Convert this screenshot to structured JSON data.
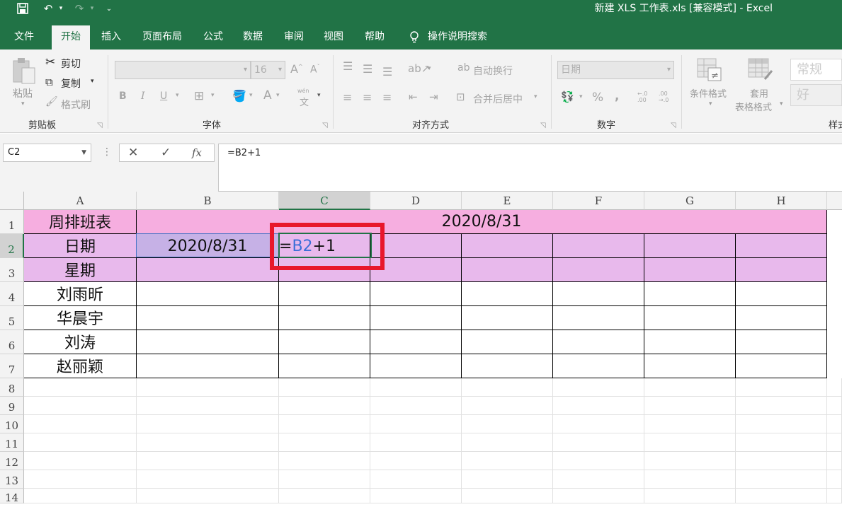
{
  "window": {
    "title": "新建 XLS 工作表.xls  [兼容模式]  -  Excel",
    "qat": {
      "save_icon": "save-icon",
      "undo_icon": "undo-icon",
      "redo_icon": "redo-icon",
      "customize_icon": "customize-qat-icon"
    }
  },
  "tabs": [
    "文件",
    "开始",
    "插入",
    "页面布局",
    "公式",
    "数据",
    "审阅",
    "视图",
    "帮助"
  ],
  "tell_me": "操作说明搜索",
  "ribbon": {
    "clipboard": {
      "paste": "粘贴",
      "cut": "剪切",
      "copy": "复制",
      "format_painter": "格式刷",
      "group": "剪贴板"
    },
    "font": {
      "font_name": "",
      "font_size": "16",
      "bold": "B",
      "italic": "I",
      "underline": "U",
      "font_color": "A",
      "phonetic": "wén",
      "phonetic_char": "文",
      "group": "字体"
    },
    "alignment": {
      "wrap_text": "自动换行",
      "merge_center": "合并后居中",
      "group": "对齐方式"
    },
    "number": {
      "format": "日期",
      "percent": "%",
      "comma": ",",
      "inc_decimal": "←.0 .00",
      "dec_decimal": ".00 →.0",
      "group": "数字"
    },
    "styles": {
      "conditional": "条件格式",
      "table_format_1": "套用",
      "table_format_2": "表格格式",
      "style_normal": "常规",
      "style_good": "好",
      "group": "样式"
    }
  },
  "formula_bar": {
    "name_box": "C2",
    "cancel": "✕",
    "enter": "✓",
    "fx": "fx",
    "formula": "=B2+1"
  },
  "sheet": {
    "columns": [
      "A",
      "B",
      "C",
      "D",
      "E",
      "F",
      "G",
      "H"
    ],
    "rows": [
      "1",
      "2",
      "3",
      "4",
      "5",
      "6",
      "7",
      "8",
      "9",
      "10",
      "11",
      "12",
      "13",
      "14"
    ],
    "a1": "周排班表",
    "b1_merged": "2020/8/31",
    "a2": "日期",
    "b2": "2020/8/31",
    "c2_eq": "=",
    "c2_ref": "B2",
    "c2_rest": "+1",
    "a3": "星期",
    "names": [
      "刘雨昕",
      "华晨宇",
      "刘涛",
      "赵丽颖"
    ]
  },
  "colors": {
    "excel_green": "#217346",
    "header_pink": "#f6aee0",
    "row_lavender": "#e8b9ec",
    "highlight_red": "#e8172b"
  }
}
